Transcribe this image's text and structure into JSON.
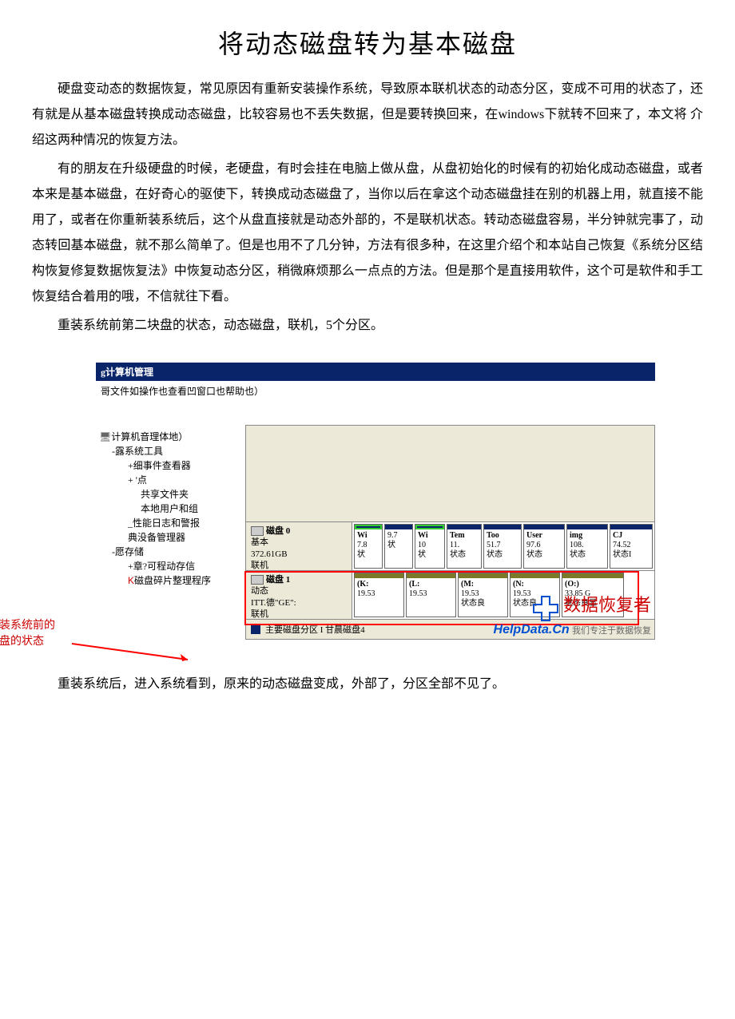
{
  "title": "将动态磁盘转为基本磁盘",
  "paras": {
    "p1": "硬盘变动态的数据恢复，常见原因有重新安装操作系统，导致原本联机状态的动态分区，变成不可用的状态了，还 有就是从基本磁盘转换成动态磁盘，比较容易也不丢失数据，但是要转换回来，在windows下就转不回来了，本文将 介绍这两种情况的恢复方法。",
    "p2": "有的朋友在升级硬盘的时候，老硬盘，有时会挂在电脑上做从盘，从盘初始化的时候有的初始化成动态磁盘，或者本来是基本磁盘，在好奇心的驱使下，转换成动态磁盘了，当你以后在拿这个动态磁盘挂在别的机器上用，就直接不能用了，或者在你重新装系统后，这个从盘直接就是动态外部的，不是联机状态。转动态磁盘容易，半分钟就完事了，动态转回基本磁盘，就不那么简单了。但是也用不了几分钟，方法有很多种，在这里介绍个和本站自己恢复《系统分区结构恢复修复数据恢复法》中恢复动态分区，稍微麻烦那么一点点的方法。但是那个是直接用软件，这个可是软件和手工恢复结合着用的哦，不信就往下看。",
    "p3": "重装系统前第二块盘的状态，动态磁盘，联机，5个分区。",
    "p4": "重装系统后，进入系统看到，原来的动态磁盘变成，外部了，分区全部不见了。"
  },
  "window": {
    "title": "g计算机管理",
    "menu": "哥文件如操作也查看凹窗口也帮助也）"
  },
  "tree": {
    "root": "计算机音理体地）",
    "systools": "-露系统工具",
    "event": "+细事件查看器",
    "dot": "+ '点",
    "shared": "共享文件夹",
    "users": "本地用户和组",
    "perf": "_性能日志和警报",
    "devmgr": "典没备管理器",
    "storage": "-愿存储",
    "remov": "+章?可程动存信",
    "defrag": "磁盘碎片整理程序"
  },
  "disk0": {
    "name": "磁盘 0",
    "type": "基本",
    "size": "372.61GB",
    "status": "联机",
    "vols": [
      {
        "n": "Wi",
        "s": "7.8",
        "st": "状"
      },
      {
        "n": "",
        "s": "9.7",
        "st": "状"
      },
      {
        "n": "Wi",
        "s": "10",
        "st": "状"
      },
      {
        "n": "Tem",
        "s": "11.",
        "st": "状态"
      },
      {
        "n": "Too",
        "s": "51.7",
        "st": "状态"
      },
      {
        "n": "User",
        "s": "97.6",
        "st": "状态"
      },
      {
        "n": "img",
        "s": "108.",
        "st": "状态"
      },
      {
        "n": "CJ",
        "s": "74.52",
        "st": "状态I"
      }
    ]
  },
  "disk1": {
    "name": "磁盘 1",
    "type": "动态",
    "size": "ITT.德\"GE\":",
    "status": "联机",
    "vols": [
      {
        "n": "(K:",
        "s": "19.53",
        "st": ""
      },
      {
        "n": "(L:",
        "s": "19.53",
        "st": ""
      },
      {
        "n": "(M:",
        "s": "19.53",
        "st": "状态良"
      },
      {
        "n": "(N:",
        "s": "19.53",
        "st": "状态良"
      },
      {
        "n": "(O:)",
        "s": "33.85 G",
        "st": "状态良显"
      }
    ]
  },
  "legend": "主要磁盘分区 I 甘晨磁盘4",
  "annotation": {
    "l1": "未装系统前的",
    "l2": "硬盘的状态"
  },
  "watermark": {
    "title": "数据恢复者",
    "domain": "HelpData.Cn",
    "tagline": "我们专注于数据恢复"
  }
}
